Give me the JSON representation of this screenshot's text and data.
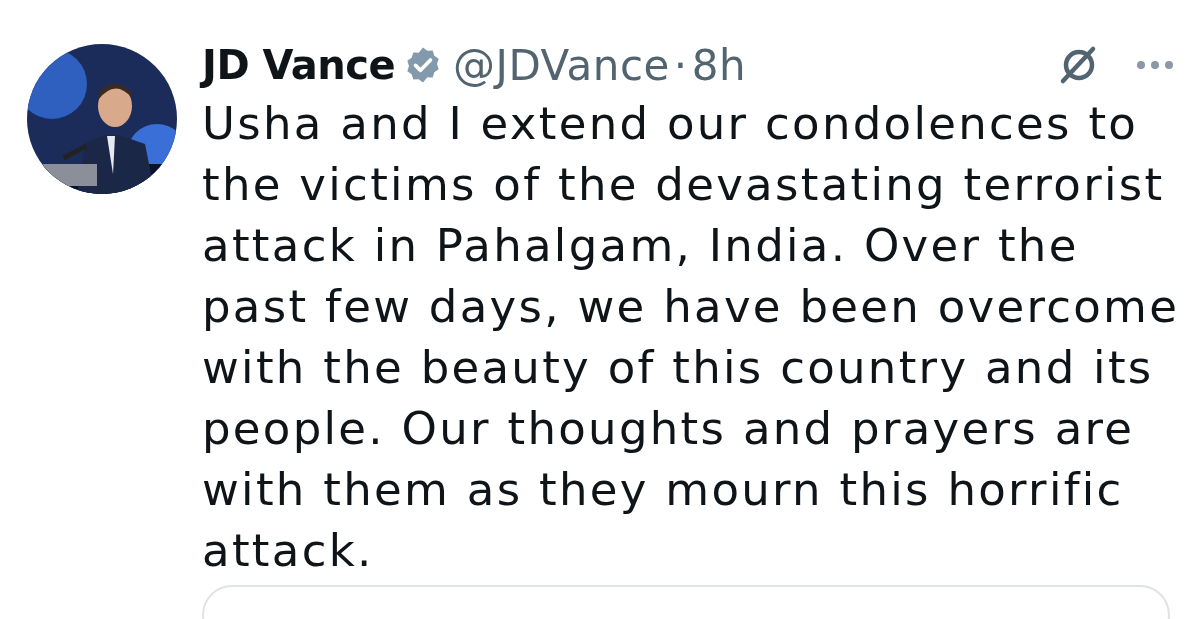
{
  "post": {
    "author": {
      "name": "JD Vance",
      "verified": true,
      "handle": "@JDVance",
      "separator": "·",
      "time": "8h"
    },
    "text": "Usha and I extend our condolences to the victims of the devastating terrorist attack in Pahalgam, India. Over the past few days, we have been overcome with the beauty of this country and its people. Our thoughts and prayers are with them as they mourn this horrific attack."
  }
}
